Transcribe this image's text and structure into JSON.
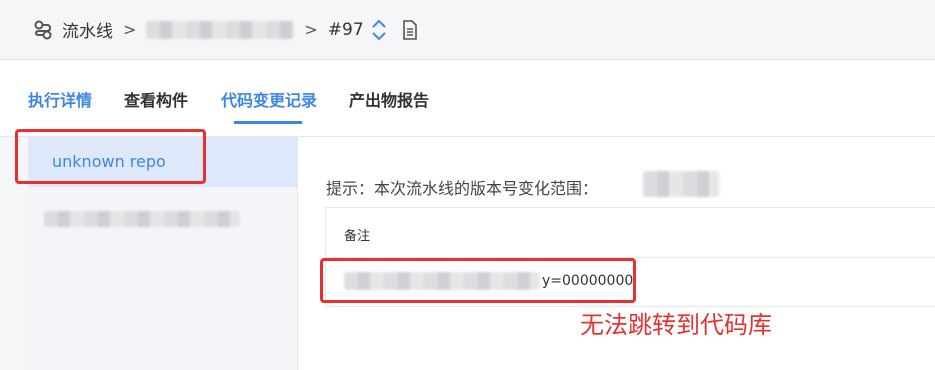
{
  "breadcrumb": {
    "pipeline_label": "流水线",
    "build_number": "#97"
  },
  "tabs": [
    {
      "label": "执行详情"
    },
    {
      "label": "查看构件"
    },
    {
      "label": "代码变更记录"
    },
    {
      "label": "产出物报告"
    }
  ],
  "sidebar": {
    "selected_repo": "unknown repo"
  },
  "main": {
    "hint_text": "提示：本次流水线的版本号变化范围：",
    "table_header": "备注",
    "row_suffix": "y=00000000"
  },
  "annotation": {
    "text": "无法跳转到代码库"
  },
  "colors": {
    "accent": "#3e86e6",
    "annotation_red": "#e8312f",
    "selected_bg": "#dde9fb"
  }
}
